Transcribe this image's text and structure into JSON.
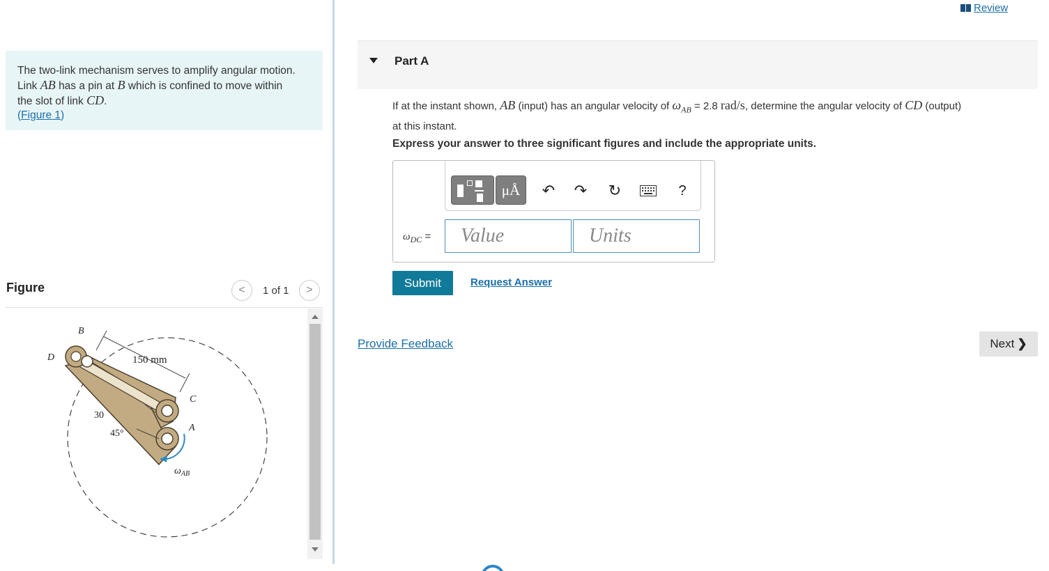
{
  "problem": {
    "intro_line1": "The two-link mechanism serves to amplify angular motion.",
    "link_word": "Link",
    "ab": "AB",
    "pin_text": "has a pin at",
    "b": "B",
    "confined_text": "which is confined to move within",
    "slot_text": "the slot of link",
    "cd": "CD",
    "period": ".",
    "figure_link_open": "(",
    "figure_link": "Figure 1",
    "figure_link_close": ")"
  },
  "figure_panel": {
    "title": "Figure",
    "pager": "1 of 1",
    "prev": "<",
    "next": ">",
    "labels": {
      "b": "B",
      "d": "D",
      "c": "C",
      "a": "A",
      "dim": "150 mm",
      "dist": "30",
      "angle": "45°",
      "omega": "ω",
      "omega_sub": "AB"
    }
  },
  "header": {
    "review": "Review"
  },
  "part": {
    "title": "Part A",
    "q_prefix": "If at the instant shown,",
    "q_ab": "AB",
    "q_mid": "(input) has an angular velocity of",
    "q_omega": "ω",
    "q_omega_sub": "AB",
    "q_equals": "= 2.8",
    "q_units": "rad/s",
    "q_after": ", determine the angular velocity of",
    "q_cd": "CD",
    "q_output": "(output)",
    "q_line2": "at this instant.",
    "instruction": "Express your answer to three significant figures and include the appropriate units."
  },
  "answer": {
    "label_omega": "ω",
    "label_sub": "DC",
    "label_eq": "=",
    "value_placeholder": "Value",
    "units_placeholder": "Units",
    "unit_button": "μÅ",
    "help": "?",
    "undo": "↶",
    "redo": "↷",
    "reset": "↻"
  },
  "actions": {
    "submit": "Submit",
    "request": "Request Answer",
    "feedback": "Provide Feedback",
    "next": "Next",
    "next_chevron": "❯"
  },
  "colors": {
    "accent": "#117a99",
    "link": "#1a6fa8",
    "intro_bg": "#e8f5f6",
    "linkage_fill": "#c2ab82"
  }
}
